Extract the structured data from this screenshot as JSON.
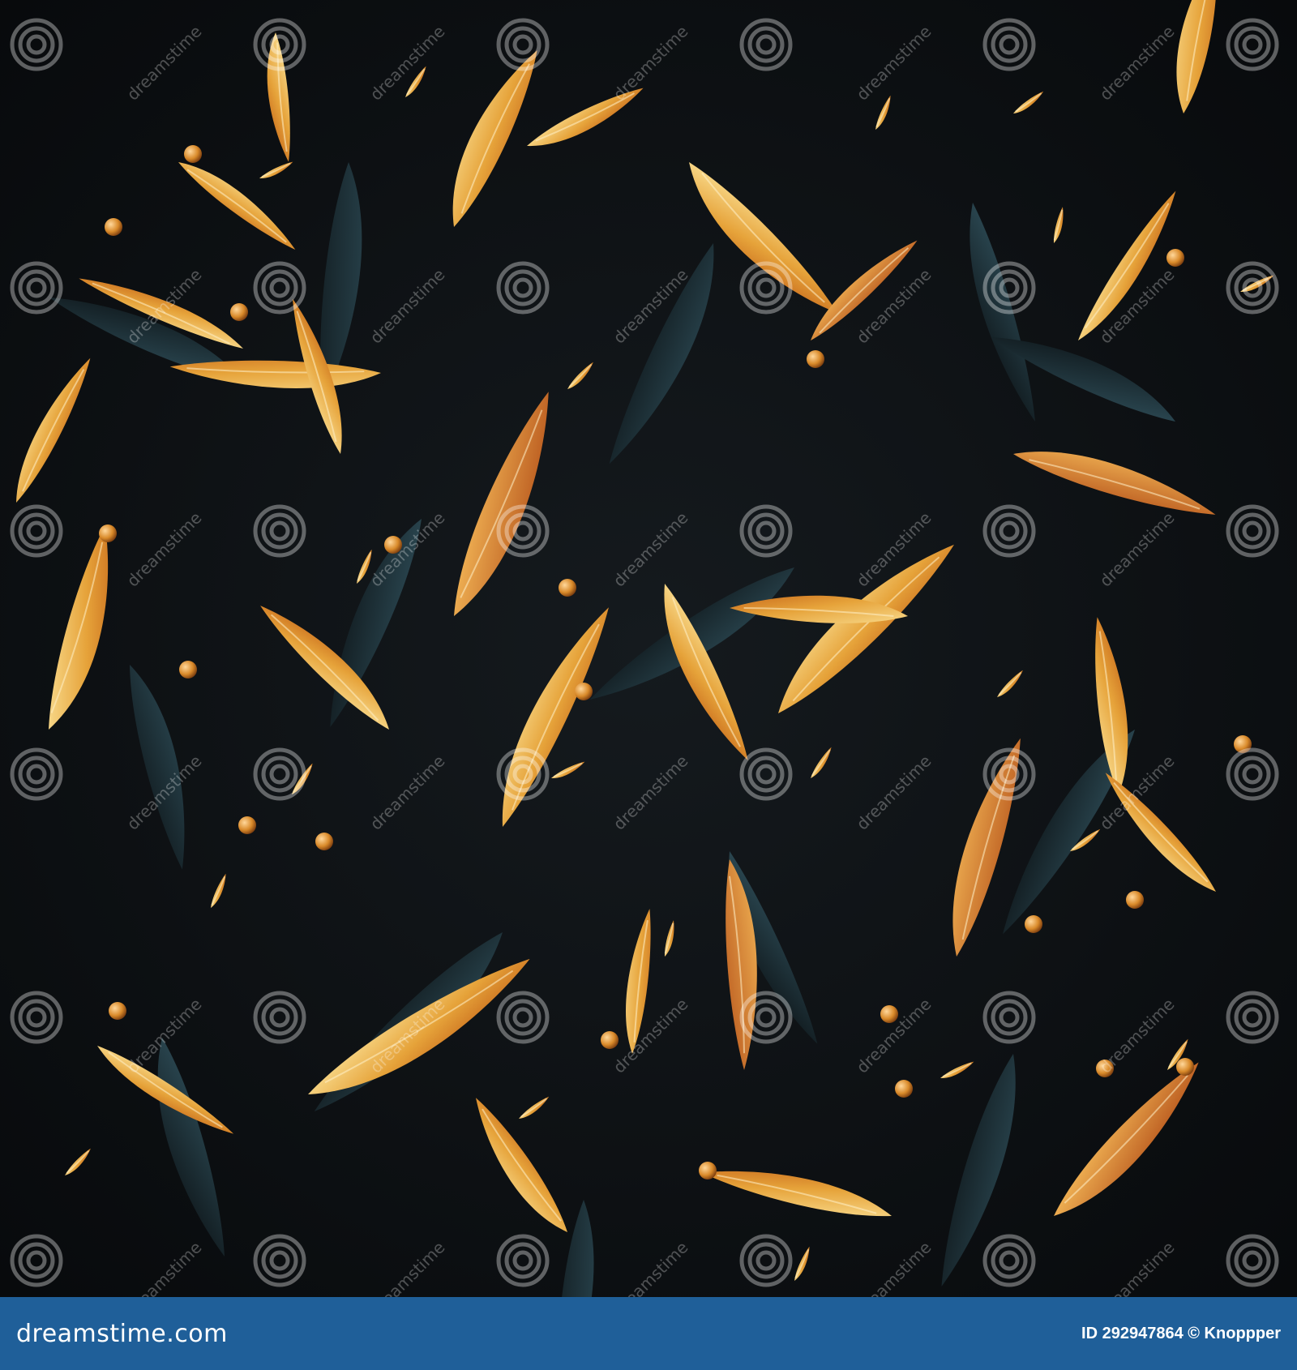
{
  "image": {
    "subject": "dark seamless pattern with golden-orange leaves and scattered beads",
    "colors": {
      "background": "#0b0d10",
      "teal_leaf": "#1c3138",
      "gold": "#e8a83a",
      "gold_light": "#f6d27a",
      "orange": "#c8641a",
      "bead": "#d98a2a",
      "footer_bar": "#1f5f99"
    }
  },
  "watermark": {
    "text": "dreamstime",
    "icon": "swirl-logo-icon"
  },
  "footer": {
    "brand": "dreamstime.com",
    "credit": "ID 292947864 © Knoppper"
  }
}
